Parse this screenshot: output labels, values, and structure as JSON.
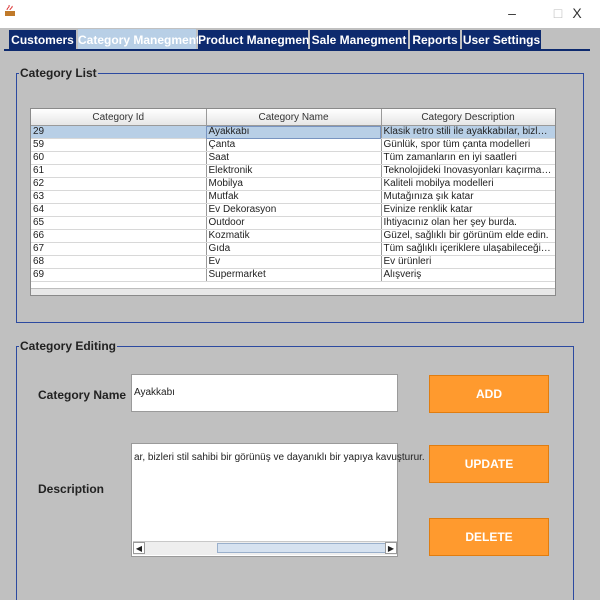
{
  "window": {
    "minimize_label": "–",
    "maximize_label": "□",
    "close_label": "X"
  },
  "tabs": [
    {
      "label": "Customers"
    },
    {
      "label": "Category Manegment"
    },
    {
      "label": "Product Manegment"
    },
    {
      "label": "Sale Manegment"
    },
    {
      "label": "Reports"
    },
    {
      "label": "User Settings"
    }
  ],
  "category_list": {
    "title": "Category List",
    "columns": [
      "Category Id",
      "Category Name",
      "Category Description"
    ],
    "rows": [
      {
        "id": "29",
        "name": "Ayakkabı",
        "description": "Klasik retro stili ile ayakkabılar, bizleri stil ..."
      },
      {
        "id": "59",
        "name": "Çanta",
        "description": "Günlük, spor tüm çanta modelleri"
      },
      {
        "id": "60",
        "name": "Saat",
        "description": "Tüm zamanların en iyi saatleri"
      },
      {
        "id": "61",
        "name": "Elektronik",
        "description": "Teknolojideki İnovasyonları kaçırmayın"
      },
      {
        "id": "62",
        "name": "Mobilya",
        "description": "Kaliteli mobilya modelleri"
      },
      {
        "id": "63",
        "name": "Mutfak",
        "description": "Mutağınıza şık katar"
      },
      {
        "id": "64",
        "name": "Ev Dekorasyon",
        "description": "Evinize renklik katar"
      },
      {
        "id": "65",
        "name": "Outdoor",
        "description": "İhtiyacınız olan her şey burda."
      },
      {
        "id": "66",
        "name": "Kozmatik",
        "description": "Güzel, sağlıklı bir görünüm elde edin."
      },
      {
        "id": "67",
        "name": "Gıda",
        "description": "Tüm sağlıklı içeriklere ulaşabileceğiniz iç..."
      },
      {
        "id": "68",
        "name": "Ev",
        "description": "Ev ürünleri"
      },
      {
        "id": "69",
        "name": "Supermarket",
        "description": "Alışveriş"
      }
    ],
    "selected_index": 0
  },
  "category_editing": {
    "title": "Category Editing",
    "name_label": "Category Name",
    "name_value": "Ayakkabı",
    "description_label": "Description",
    "description_value": "ar, bizleri stil sahibi bir görünüş ve dayanıklı bir yapıya kavuşturur.",
    "add_label": "ADD",
    "update_label": "UPDATE",
    "delete_label": "DELETE"
  },
  "colors": {
    "tab_bg": "#0d2a6e",
    "tab_active_bg": "#b8cfe6",
    "button_bg": "#ff9a2e",
    "group_border": "#2c4aa0",
    "panel_bg": "#c0c0c0",
    "selection_bg": "#b8cfe6"
  }
}
